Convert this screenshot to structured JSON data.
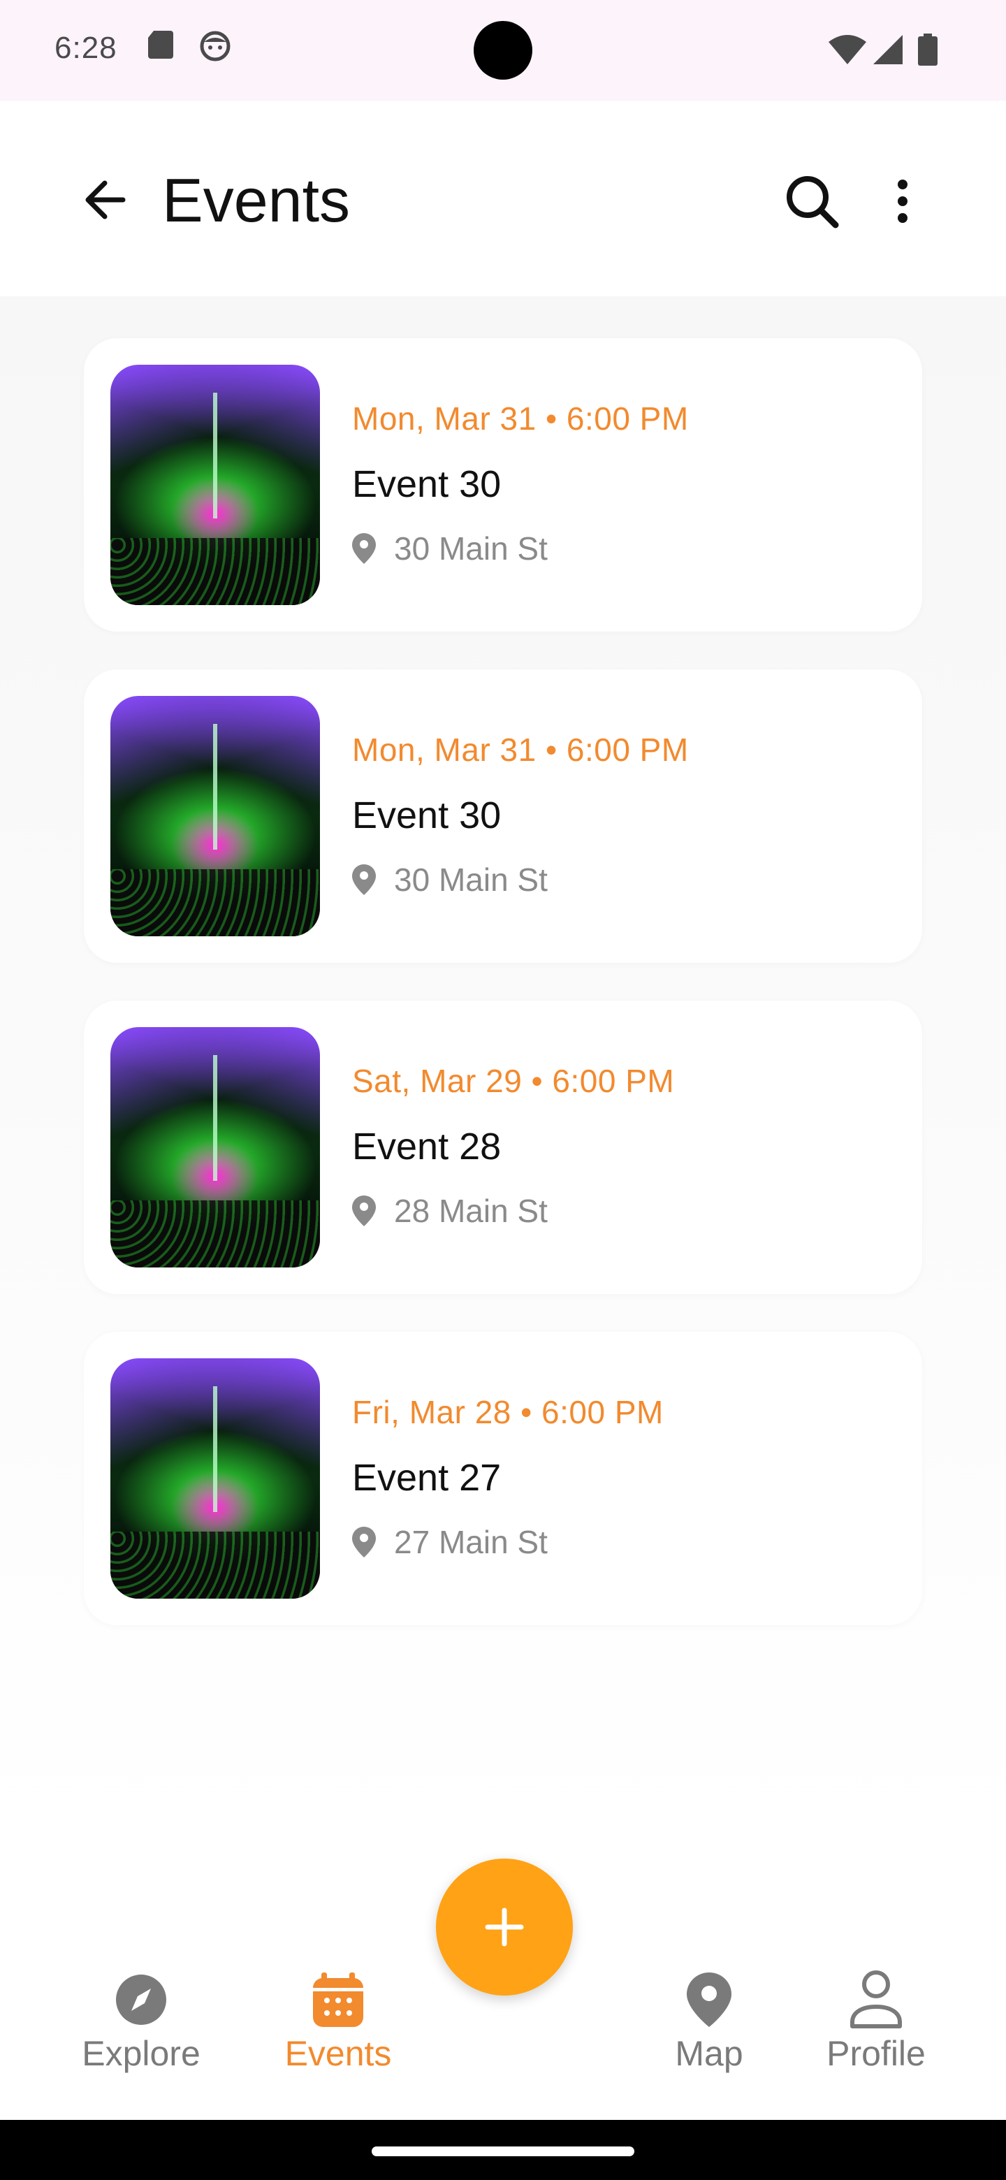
{
  "status_bar": {
    "time": "6:28",
    "icons": [
      "sd-card-icon",
      "face-icon",
      "wifi-icon",
      "signal-icon",
      "battery-icon"
    ]
  },
  "app_bar": {
    "title": "Events",
    "icons": {
      "back": "back-arrow-icon",
      "search": "search-icon",
      "more": "more-vert-icon"
    }
  },
  "events": [
    {
      "date": "Mon, Mar 31 • 6:00 PM",
      "title": "Event 30",
      "location": "30 Main St"
    },
    {
      "date": "Mon, Mar 31 • 6:00 PM",
      "title": "Event 30",
      "location": "30 Main St"
    },
    {
      "date": "Sat, Mar 29 • 6:00 PM",
      "title": "Event 28",
      "location": "28 Main St"
    },
    {
      "date": "Fri, Mar 28 • 6:00 PM",
      "title": "Event 27",
      "location": "27 Main St"
    }
  ],
  "fab": {
    "icon": "plus-icon"
  },
  "bottom_nav": {
    "items": [
      {
        "label": "Explore",
        "icon": "compass-icon",
        "active": false
      },
      {
        "label": "Events",
        "icon": "calendar-icon",
        "active": true
      },
      {
        "label": "Map",
        "icon": "map-pin-icon",
        "active": false
      },
      {
        "label": "Profile",
        "icon": "person-icon",
        "active": false
      }
    ]
  },
  "colors": {
    "accent": "#f28a2e",
    "fab": "#ffa215",
    "status_bar_bg": "#fdf3fb",
    "inactive": "#7a7a7a"
  }
}
